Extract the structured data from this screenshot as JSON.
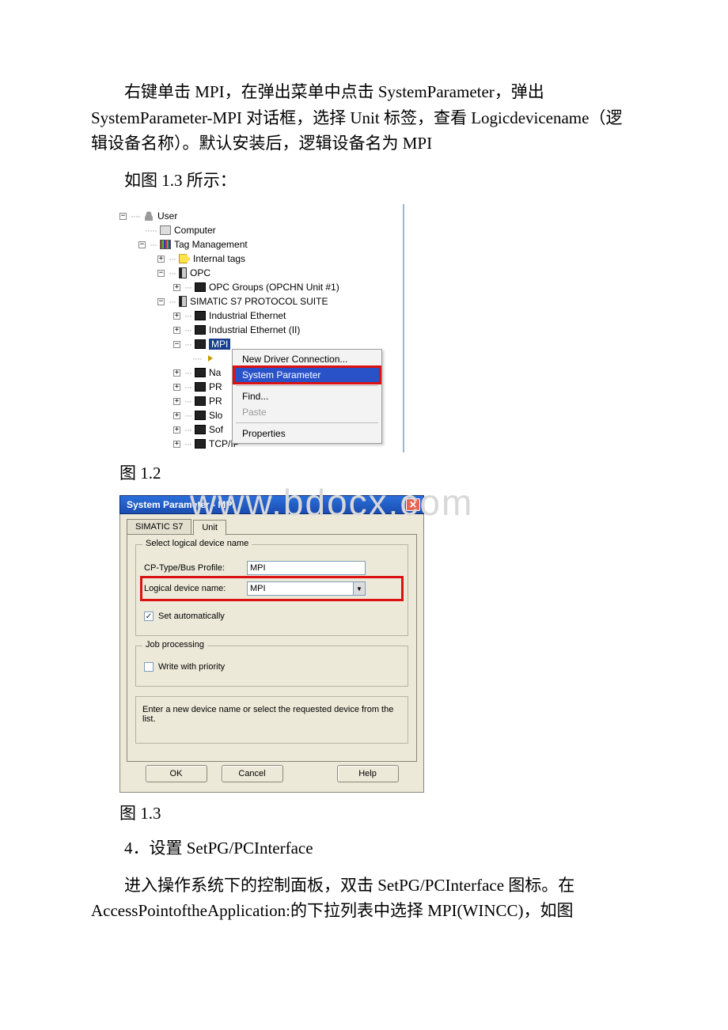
{
  "paragraphs": {
    "p1": "右键单击 MPI，在弹出菜单中点击 SystemParameter，弹出 SystemParameter-MPI 对话框，选择 Unit 标签，查看 Logicdevicename（逻辑设备名称）。默认安装后，逻辑设备名为 MPI",
    "p2": "如图 1.3 所示：",
    "cap12": "图 1.2",
    "cap13": "图 1.3",
    "p4": "4．设置 SetPG/PCInterface",
    "p5": "进入操作系统下的控制面板，双击 SetPG/PCInterface 图标。在 AccessPointoftheApplication:的下拉列表中选择 MPI(WINCC)，如图"
  },
  "watermark": "www.bdocx.com",
  "tree": {
    "user": "User",
    "computer": "Computer",
    "tagmgmt": "Tag Management",
    "internal": "Internal tags",
    "opc": "OPC",
    "opcgroups": "OPC Groups (OPCHN Unit #1)",
    "s7suite": "SIMATIC S7 PROTOCOL SUITE",
    "ie": "Industrial Ethernet",
    "ie2": "Industrial Ethernet (II)",
    "mpi": "MPI",
    "na": "Na",
    "pr1": "PR",
    "pr2": "PR",
    "slo": "Slo",
    "sof": "Sof",
    "tcp": "TCP/IP"
  },
  "menu": {
    "newconn": "New Driver Connection...",
    "sysparam": "System Parameter",
    "find": "Find...",
    "paste": "Paste",
    "props": "Properties"
  },
  "dialog": {
    "title": "System Parameter - MPI",
    "tab1": "SIMATIC S7",
    "tab2": "Unit",
    "grp1": "Select logical device name",
    "lbl_cp": "CP-Type/Bus Profile:",
    "val_cp": "MPI",
    "lbl_logical": "Logical device name:",
    "val_logical": "MPI",
    "chk_auto": "Set automatically",
    "grp2": "Job processing",
    "chk_write": "Write with priority",
    "hint": "Enter a new device name or select the requested device from the list.",
    "btn_ok": "OK",
    "btn_cancel": "Cancel",
    "btn_help": "Help"
  }
}
